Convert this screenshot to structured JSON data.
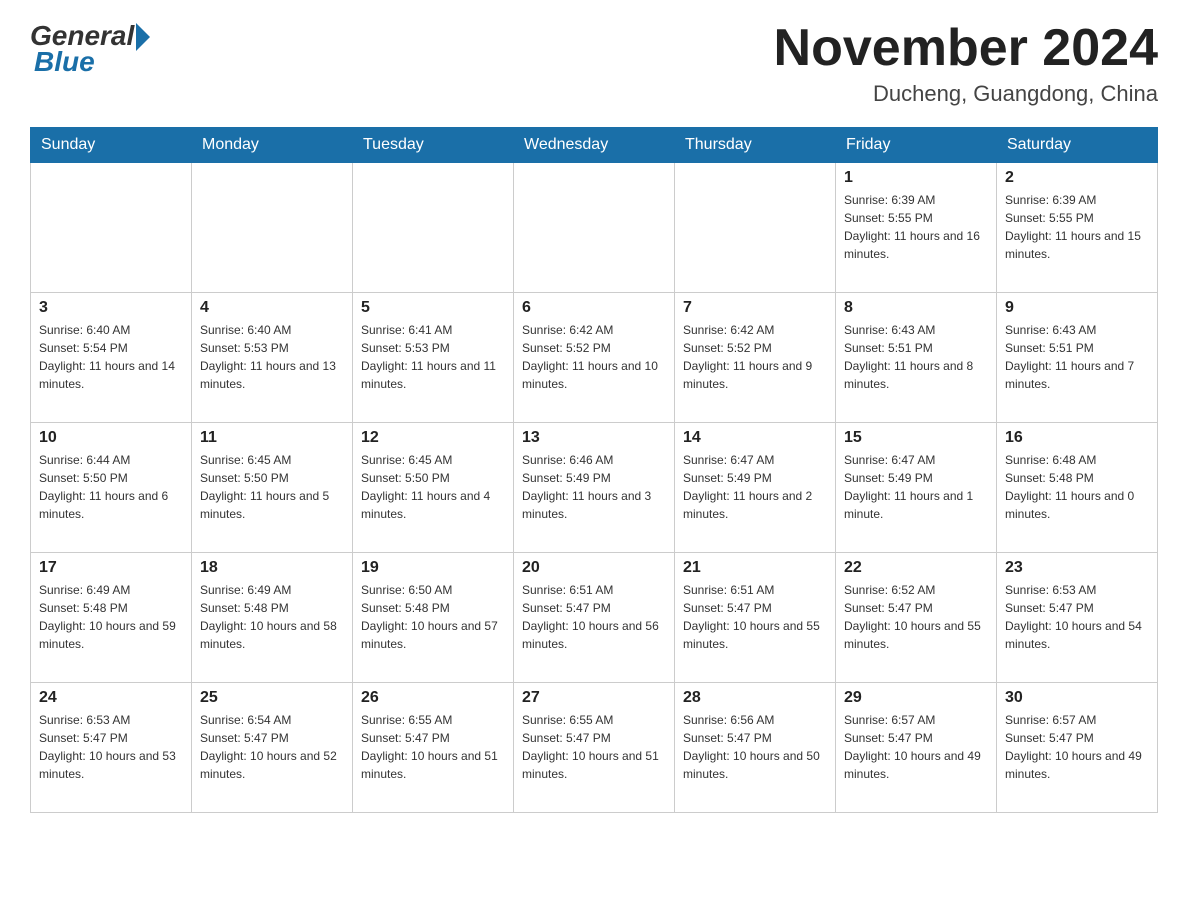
{
  "header": {
    "logo_general": "General",
    "logo_blue": "Blue",
    "month_title": "November 2024",
    "location": "Ducheng, Guangdong, China"
  },
  "days_of_week": [
    "Sunday",
    "Monday",
    "Tuesday",
    "Wednesday",
    "Thursday",
    "Friday",
    "Saturday"
  ],
  "weeks": [
    [
      {
        "day": "",
        "info": ""
      },
      {
        "day": "",
        "info": ""
      },
      {
        "day": "",
        "info": ""
      },
      {
        "day": "",
        "info": ""
      },
      {
        "day": "",
        "info": ""
      },
      {
        "day": "1",
        "info": "Sunrise: 6:39 AM\nSunset: 5:55 PM\nDaylight: 11 hours and 16 minutes."
      },
      {
        "day": "2",
        "info": "Sunrise: 6:39 AM\nSunset: 5:55 PM\nDaylight: 11 hours and 15 minutes."
      }
    ],
    [
      {
        "day": "3",
        "info": "Sunrise: 6:40 AM\nSunset: 5:54 PM\nDaylight: 11 hours and 14 minutes."
      },
      {
        "day": "4",
        "info": "Sunrise: 6:40 AM\nSunset: 5:53 PM\nDaylight: 11 hours and 13 minutes."
      },
      {
        "day": "5",
        "info": "Sunrise: 6:41 AM\nSunset: 5:53 PM\nDaylight: 11 hours and 11 minutes."
      },
      {
        "day": "6",
        "info": "Sunrise: 6:42 AM\nSunset: 5:52 PM\nDaylight: 11 hours and 10 minutes."
      },
      {
        "day": "7",
        "info": "Sunrise: 6:42 AM\nSunset: 5:52 PM\nDaylight: 11 hours and 9 minutes."
      },
      {
        "day": "8",
        "info": "Sunrise: 6:43 AM\nSunset: 5:51 PM\nDaylight: 11 hours and 8 minutes."
      },
      {
        "day": "9",
        "info": "Sunrise: 6:43 AM\nSunset: 5:51 PM\nDaylight: 11 hours and 7 minutes."
      }
    ],
    [
      {
        "day": "10",
        "info": "Sunrise: 6:44 AM\nSunset: 5:50 PM\nDaylight: 11 hours and 6 minutes."
      },
      {
        "day": "11",
        "info": "Sunrise: 6:45 AM\nSunset: 5:50 PM\nDaylight: 11 hours and 5 minutes."
      },
      {
        "day": "12",
        "info": "Sunrise: 6:45 AM\nSunset: 5:50 PM\nDaylight: 11 hours and 4 minutes."
      },
      {
        "day": "13",
        "info": "Sunrise: 6:46 AM\nSunset: 5:49 PM\nDaylight: 11 hours and 3 minutes."
      },
      {
        "day": "14",
        "info": "Sunrise: 6:47 AM\nSunset: 5:49 PM\nDaylight: 11 hours and 2 minutes."
      },
      {
        "day": "15",
        "info": "Sunrise: 6:47 AM\nSunset: 5:49 PM\nDaylight: 11 hours and 1 minute."
      },
      {
        "day": "16",
        "info": "Sunrise: 6:48 AM\nSunset: 5:48 PM\nDaylight: 11 hours and 0 minutes."
      }
    ],
    [
      {
        "day": "17",
        "info": "Sunrise: 6:49 AM\nSunset: 5:48 PM\nDaylight: 10 hours and 59 minutes."
      },
      {
        "day": "18",
        "info": "Sunrise: 6:49 AM\nSunset: 5:48 PM\nDaylight: 10 hours and 58 minutes."
      },
      {
        "day": "19",
        "info": "Sunrise: 6:50 AM\nSunset: 5:48 PM\nDaylight: 10 hours and 57 minutes."
      },
      {
        "day": "20",
        "info": "Sunrise: 6:51 AM\nSunset: 5:47 PM\nDaylight: 10 hours and 56 minutes."
      },
      {
        "day": "21",
        "info": "Sunrise: 6:51 AM\nSunset: 5:47 PM\nDaylight: 10 hours and 55 minutes."
      },
      {
        "day": "22",
        "info": "Sunrise: 6:52 AM\nSunset: 5:47 PM\nDaylight: 10 hours and 55 minutes."
      },
      {
        "day": "23",
        "info": "Sunrise: 6:53 AM\nSunset: 5:47 PM\nDaylight: 10 hours and 54 minutes."
      }
    ],
    [
      {
        "day": "24",
        "info": "Sunrise: 6:53 AM\nSunset: 5:47 PM\nDaylight: 10 hours and 53 minutes."
      },
      {
        "day": "25",
        "info": "Sunrise: 6:54 AM\nSunset: 5:47 PM\nDaylight: 10 hours and 52 minutes."
      },
      {
        "day": "26",
        "info": "Sunrise: 6:55 AM\nSunset: 5:47 PM\nDaylight: 10 hours and 51 minutes."
      },
      {
        "day": "27",
        "info": "Sunrise: 6:55 AM\nSunset: 5:47 PM\nDaylight: 10 hours and 51 minutes."
      },
      {
        "day": "28",
        "info": "Sunrise: 6:56 AM\nSunset: 5:47 PM\nDaylight: 10 hours and 50 minutes."
      },
      {
        "day": "29",
        "info": "Sunrise: 6:57 AM\nSunset: 5:47 PM\nDaylight: 10 hours and 49 minutes."
      },
      {
        "day": "30",
        "info": "Sunrise: 6:57 AM\nSunset: 5:47 PM\nDaylight: 10 hours and 49 minutes."
      }
    ]
  ]
}
